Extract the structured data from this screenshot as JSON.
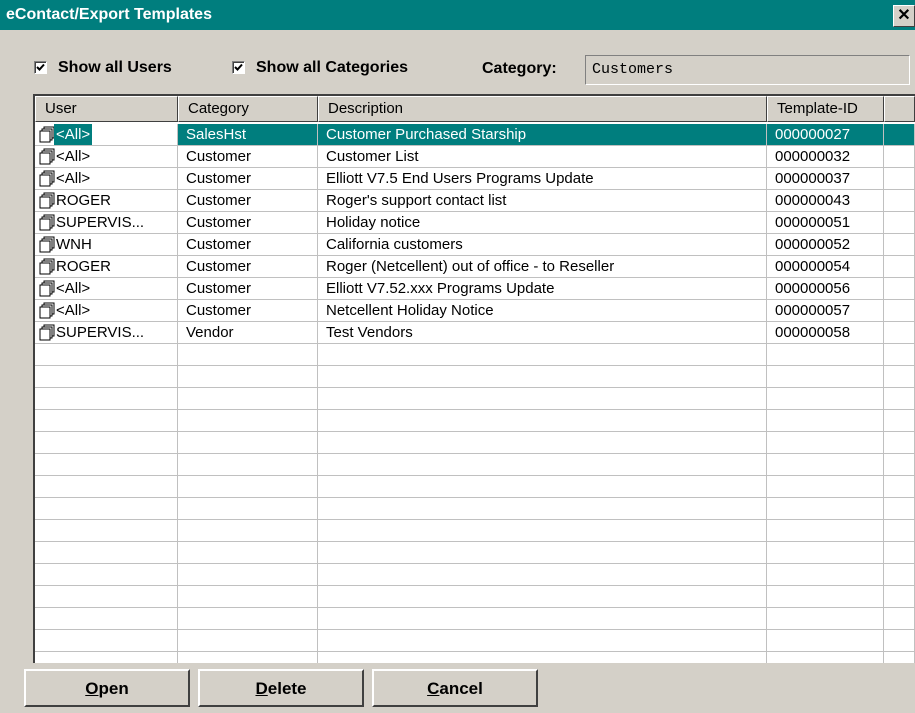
{
  "window": {
    "title": "eContact/Export Templates",
    "close_glyph": "✕"
  },
  "filters": {
    "show_all_users": {
      "label": "Show all Users",
      "checked": true
    },
    "show_all_categories": {
      "label": "Show all Categories",
      "checked": true
    },
    "category_label": "Category:",
    "category_value": "Customers"
  },
  "grid": {
    "columns": [
      "User",
      "Category",
      "Description",
      "Template-ID"
    ],
    "rows": [
      {
        "user": "<All>",
        "category": "SalesHst",
        "description": "Customer Purchased Starship",
        "template_id": "000000027",
        "selected": true
      },
      {
        "user": "<All>",
        "category": "Customer",
        "description": "Customer List",
        "template_id": "000000032"
      },
      {
        "user": "<All>",
        "category": "Customer",
        "description": "Elliott V7.5 End Users Programs Update",
        "template_id": "000000037"
      },
      {
        "user": "ROGER",
        "category": "Customer",
        "description": "Roger's support contact list",
        "template_id": "000000043"
      },
      {
        "user": "SUPERVIS...",
        "category": "Customer",
        "description": "Holiday notice",
        "template_id": "000000051"
      },
      {
        "user": "WNH",
        "category": "Customer",
        "description": "California customers",
        "template_id": "000000052"
      },
      {
        "user": "ROGER",
        "category": "Customer",
        "description": "Roger (Netcellent) out of office - to Reseller",
        "template_id": "000000054"
      },
      {
        "user": "<All>",
        "category": "Customer",
        "description": "Elliott V7.52.xxx Programs Update",
        "template_id": "000000056"
      },
      {
        "user": "<All>",
        "category": "Customer",
        "description": "Netcellent Holiday Notice",
        "template_id": "000000057"
      },
      {
        "user": "SUPERVIS...",
        "category": "Vendor",
        "description": "Test Vendors",
        "template_id": "000000058"
      }
    ],
    "row_icon": "documents-icon"
  },
  "buttons": {
    "open": {
      "mnemonic": "O",
      "rest": "pen"
    },
    "delete": {
      "mnemonic": "D",
      "rest": "elete"
    },
    "cancel": {
      "mnemonic": "C",
      "rest": "ancel"
    }
  },
  "colors": {
    "titlebar": "#007e7e",
    "selection": "#007e7e",
    "face": "#d4d0c8"
  }
}
